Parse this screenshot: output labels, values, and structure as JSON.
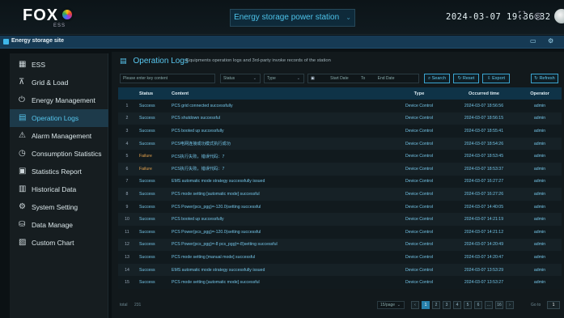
{
  "app": {
    "logo": "FOX",
    "logo_sub": "ESS",
    "station": "Energy storage power station",
    "clock": "2024-03-07  19:36:32"
  },
  "site": {
    "title": "Energy storage site"
  },
  "sidebar": {
    "items": [
      {
        "label": "ESS",
        "icon": "grid-icon"
      },
      {
        "label": "Grid & Load",
        "icon": "tower-icon"
      },
      {
        "label": "Energy Management",
        "icon": "power-icon"
      },
      {
        "label": "Operation Logs",
        "icon": "log-icon",
        "active": true
      },
      {
        "label": "Alarm Management",
        "icon": "warning-icon"
      },
      {
        "label": "Consumption Statistics",
        "icon": "stats-icon"
      },
      {
        "label": "Statistics Report",
        "icon": "report-icon"
      },
      {
        "label": "Historical Data",
        "icon": "history-icon"
      },
      {
        "label": "System Setting",
        "icon": "gear-icon"
      },
      {
        "label": "Data Manage",
        "icon": "database-icon"
      },
      {
        "label": "Custom Chart",
        "icon": "chart-icon"
      }
    ]
  },
  "page": {
    "title": "Operation Logs",
    "subtitle": "Equipments operation logs and 3rd-party invoke records of the station"
  },
  "filters": {
    "keyword_placeholder": "Please enter key content",
    "status_placeholder": "Status",
    "type_placeholder": "Type",
    "start_placeholder": "Start Date",
    "to_label": "To",
    "end_placeholder": "End Date",
    "search": "Search",
    "reset": "Reset",
    "export": "Export",
    "refresh": "Refresh"
  },
  "table": {
    "headers": [
      "",
      "Status",
      "Content",
      "Type",
      "Occurred time",
      "Operator"
    ],
    "rows": [
      [
        "1",
        "Success",
        "PCS grid connected successfully",
        "Device Control",
        "2024-03-07 18:56:56",
        "admin"
      ],
      [
        "2",
        "Success",
        "PCS shutdown successful",
        "Device Control",
        "2024-03-07 18:56:15",
        "admin"
      ],
      [
        "3",
        "Success",
        "PCS booted up successfully",
        "Device Control",
        "2024-03-07 18:55:41",
        "admin"
      ],
      [
        "4",
        "Success",
        "PCS电网连接成功模式执行成功",
        "Device Control",
        "2024-03-07 18:54:26",
        "admin"
      ],
      [
        "5",
        "Failure",
        "PCS执行失败，错误代码：7",
        "Device Control",
        "2024-03-07 18:53:45",
        "admin"
      ],
      [
        "6",
        "Failure",
        "PCS执行失败，错误代码：7",
        "Device Control",
        "2024-03-07 18:53:37",
        "admin"
      ],
      [
        "7",
        "Success",
        "EMS automatic mode strategy successfully issued",
        "Device Control",
        "2024-03-07 16:27:27",
        "admin"
      ],
      [
        "8",
        "Success",
        "PCS mode setting [automatic mode] successful",
        "Device Control",
        "2024-03-07 16:27:26",
        "admin"
      ],
      [
        "9",
        "Success",
        "PCS Power(pcs_pgg)=-120.0)setting successful",
        "Device Control",
        "2024-03-07 14:40:05",
        "admin"
      ],
      [
        "10",
        "Success",
        "PCS booted up successfully",
        "Device Control",
        "2024-03-07 14:21:19",
        "admin"
      ],
      [
        "11",
        "Success",
        "PCS Power(pcs_pgg)=-120.0)setting successful",
        "Device Control",
        "2024-03-07 14:21:12",
        "admin"
      ],
      [
        "12",
        "Success",
        "PCS Power(pcs_pgg)=-8 pcs_pgg)=-8)setting successful",
        "Device Control",
        "2024-03-07 14:20:49",
        "admin"
      ],
      [
        "13",
        "Success",
        "PCS mode setting [manual mode] successful",
        "Device Control",
        "2024-03-07 14:20:47",
        "admin"
      ],
      [
        "14",
        "Success",
        "EMS automatic mode strategy successfully issued",
        "Device Control",
        "2024-03-07 13:53:29",
        "admin"
      ],
      [
        "15",
        "Success",
        "PCS mode setting [automatic mode] successful",
        "Device Control",
        "2024-03-07 13:53:27",
        "admin"
      ]
    ]
  },
  "pager": {
    "total_label": "total",
    "total": "231",
    "page_size": "15/page",
    "pages": [
      "1",
      "2",
      "3",
      "4",
      "5",
      "6",
      "...",
      "16"
    ],
    "goto_label": "Go to",
    "goto_value": "1"
  },
  "colors": {
    "accent": "#56c6ee",
    "failure": "#e5a24c",
    "header_bg": "#0f3347"
  }
}
